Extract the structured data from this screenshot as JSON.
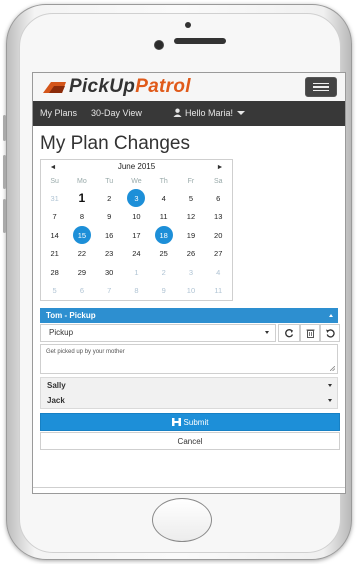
{
  "brand": {
    "logo_text_pickup": "PickUp",
    "logo_text_patrol": "Patrol",
    "accent_orange": "#e05a1a",
    "accent_blue": "#1d8fd8"
  },
  "nav": {
    "my_plans": "My Plans",
    "thirty_day_view": "30-Day View",
    "user_greeting": "Hello Maria!"
  },
  "page": {
    "title": "My Plan Changes"
  },
  "calendar": {
    "prev": "◄",
    "next": "►",
    "month_title": "June 2015",
    "dow": [
      "Su",
      "Mo",
      "Tu",
      "We",
      "Th",
      "Fr",
      "Sa"
    ],
    "weeks": [
      [
        {
          "d": "31",
          "m": 1
        },
        {
          "d": "1",
          "today": 1
        },
        {
          "d": "2"
        },
        {
          "d": "3",
          "sel": 1
        },
        {
          "d": "4"
        },
        {
          "d": "5"
        },
        {
          "d": "6"
        }
      ],
      [
        {
          "d": "7"
        },
        {
          "d": "8"
        },
        {
          "d": "9"
        },
        {
          "d": "10"
        },
        {
          "d": "11"
        },
        {
          "d": "12"
        },
        {
          "d": "13"
        }
      ],
      [
        {
          "d": "14"
        },
        {
          "d": "15",
          "sel": 1
        },
        {
          "d": "16"
        },
        {
          "d": "17"
        },
        {
          "d": "18",
          "sel": 1
        },
        {
          "d": "19"
        },
        {
          "d": "20"
        }
      ],
      [
        {
          "d": "21"
        },
        {
          "d": "22"
        },
        {
          "d": "23"
        },
        {
          "d": "24"
        },
        {
          "d": "25"
        },
        {
          "d": "26"
        },
        {
          "d": "27"
        }
      ],
      [
        {
          "d": "28"
        },
        {
          "d": "29"
        },
        {
          "d": "30"
        },
        {
          "d": "1",
          "m": 1
        },
        {
          "d": "2",
          "m": 1
        },
        {
          "d": "3",
          "m": 1
        },
        {
          "d": "4",
          "m": 1
        }
      ],
      [
        {
          "d": "5",
          "m": 1
        },
        {
          "d": "6",
          "m": 1
        },
        {
          "d": "7",
          "m": 1
        },
        {
          "d": "8",
          "m": 1
        },
        {
          "d": "9",
          "m": 1
        },
        {
          "d": "10",
          "m": 1
        },
        {
          "d": "11",
          "m": 1
        }
      ]
    ]
  },
  "plan": {
    "active_header": "Tom - Pickup",
    "type_value": "Pickup",
    "notes": "Get picked up by your mother",
    "collapsed": [
      "Sally",
      "Jack"
    ]
  },
  "actions": {
    "submit": "Submit",
    "cancel": "Cancel"
  }
}
